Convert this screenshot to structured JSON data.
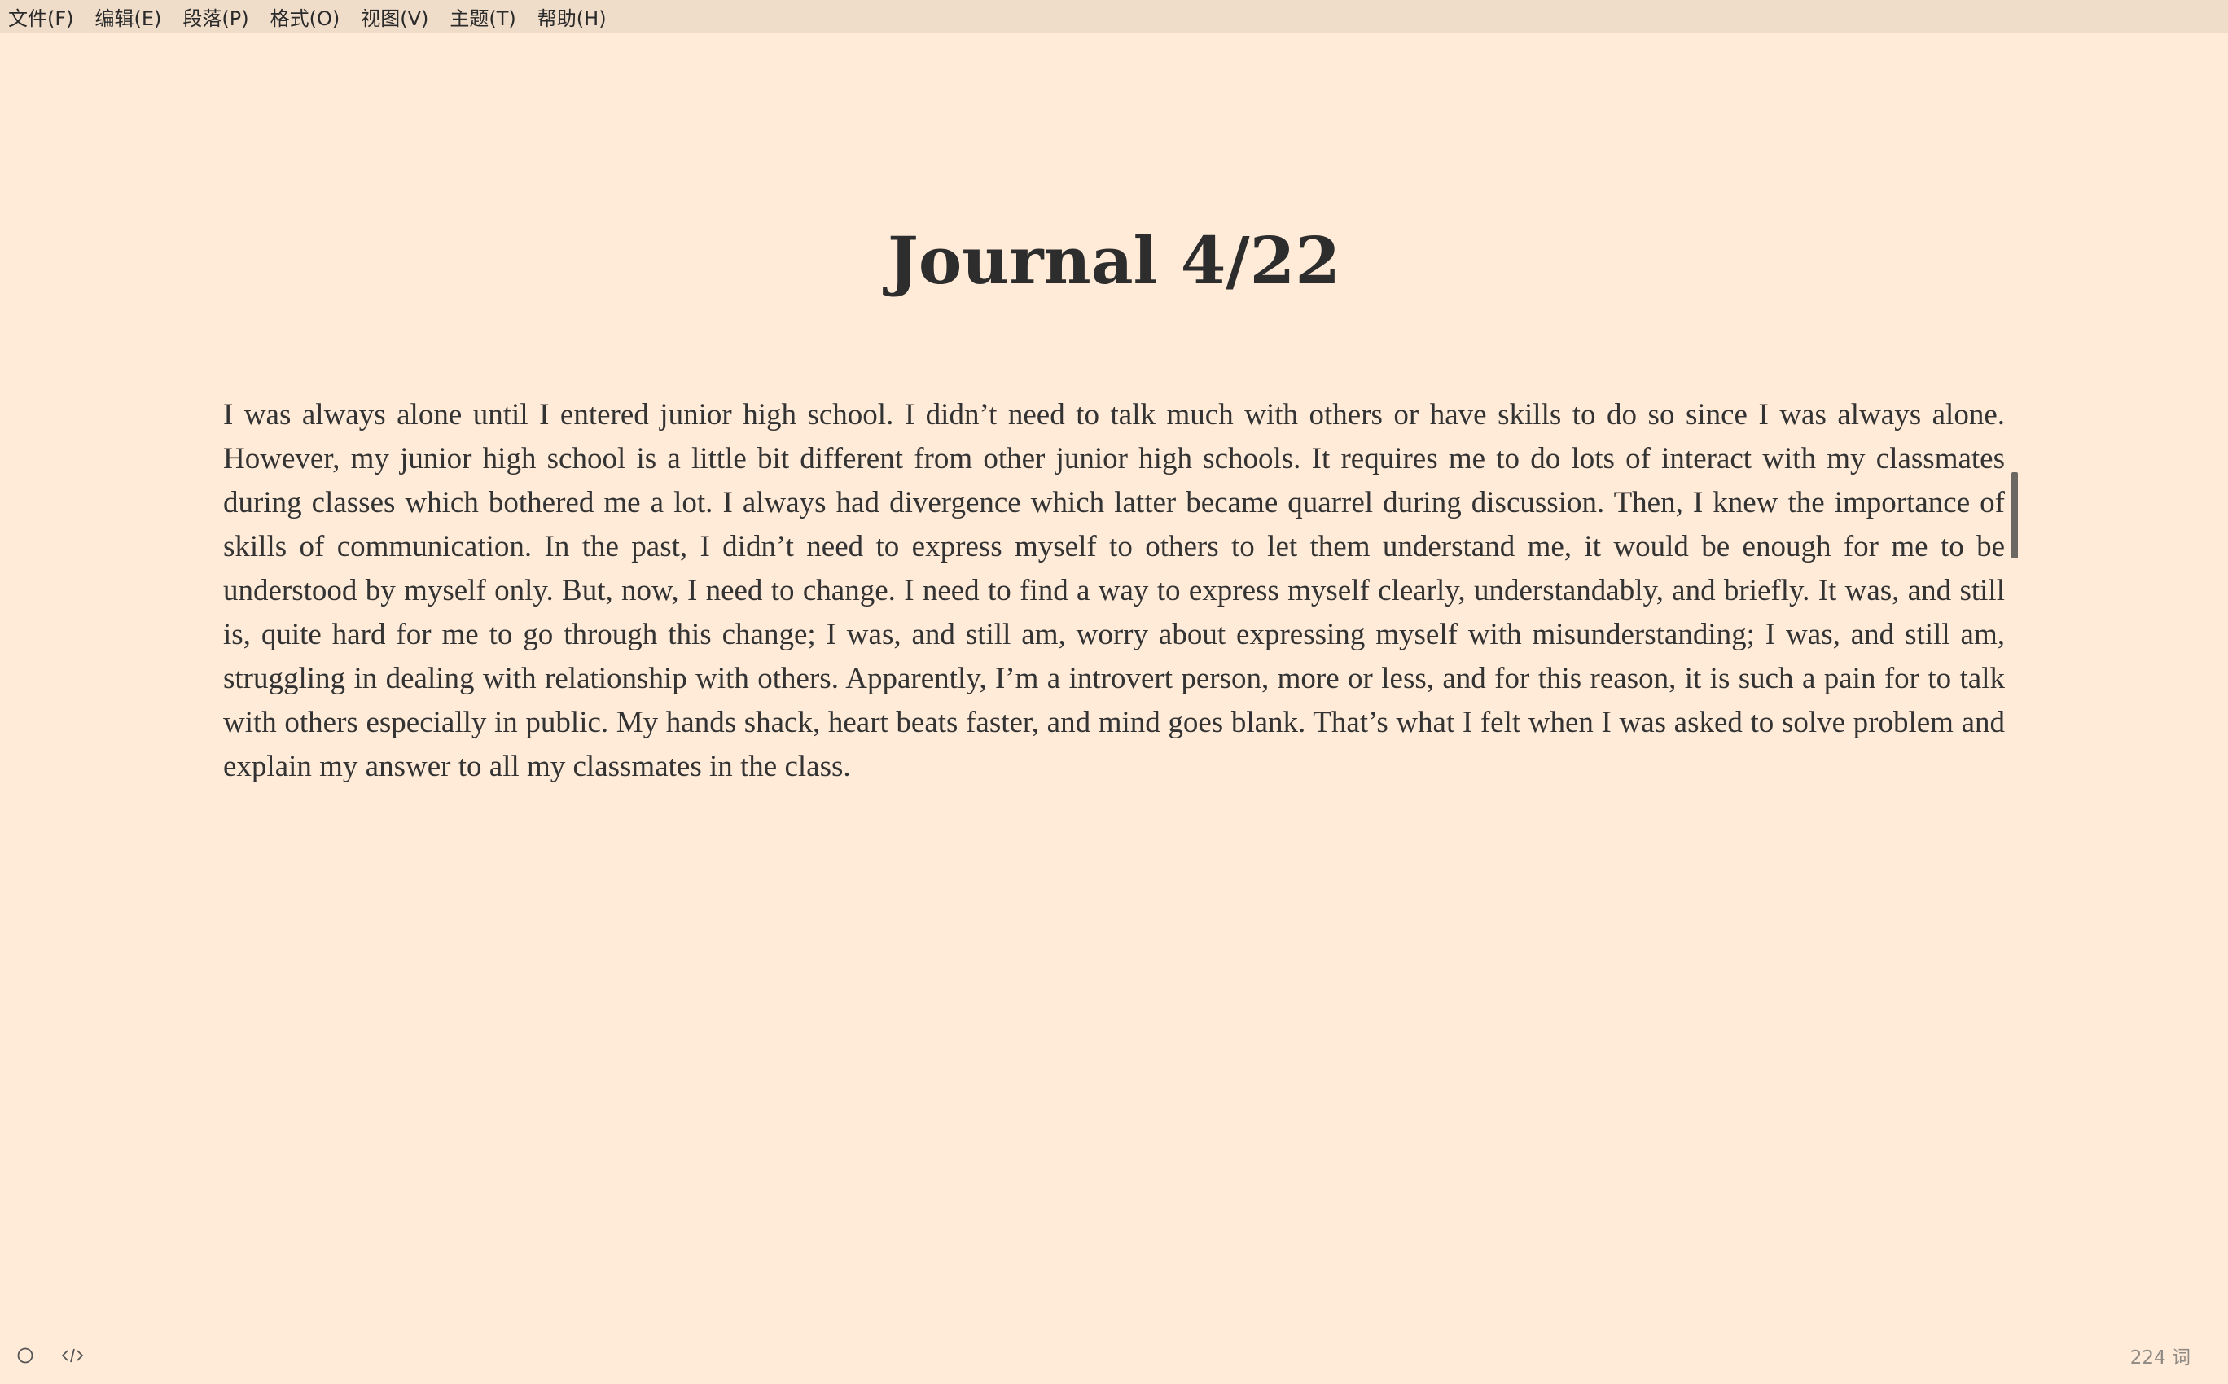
{
  "menubar": {
    "items": [
      {
        "label": "文件(F)"
      },
      {
        "label": "编辑(E)"
      },
      {
        "label": "段落(P)"
      },
      {
        "label": "格式(O)"
      },
      {
        "label": "视图(V)"
      },
      {
        "label": "主题(T)"
      },
      {
        "label": "帮助(H)"
      }
    ]
  },
  "document": {
    "title": "Journal 4/22",
    "body": "I was always alone until I entered junior high school. I didn’t need to talk much with others or have skills to do so since I was always alone. However, my junior high school is a little bit different from other junior high schools. It requires me to do lots of interact with my classmates during classes which bothered me a lot. I always had divergence which latter became quarrel during discussion. Then, I knew the importance of skills of communication. In the past, I didn’t need to express myself to others to let them understand me, it would be enough for me to be understood by myself only. But, now, I need to change. I need to find a way to express myself clearly, understandably, and briefly. It was, and still is, quite hard for me to go through this change; I was, and still am, worry about expressing myself with misunderstanding; I was, and still am, struggling in dealing with relationship with others. Apparently, I’m a introvert person, more or less, and for this reason, it is such a pain for to talk with others especially in public. My hands shack, heart beats faster, and mind goes blank. That’s what I felt when I was asked to solve problem and explain my answer to all my classmates in the class."
  },
  "footer": {
    "left_icons": [
      "circle-icon",
      "source-code-icon"
    ],
    "word_count": "224 词"
  },
  "colors": {
    "background": "#ffebd8",
    "menubar": "#efdcc9",
    "text": "#333333",
    "scrollbar": "#6b6762"
  }
}
